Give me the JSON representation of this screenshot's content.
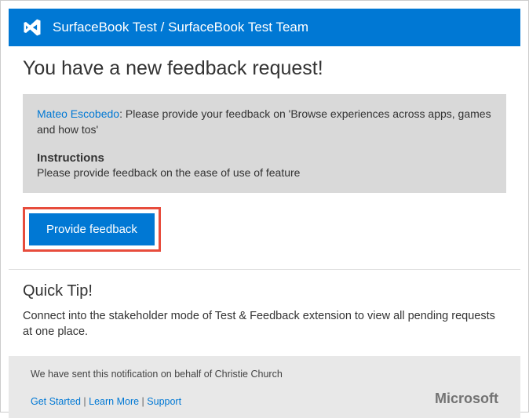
{
  "header": {
    "title": "SurfaceBook Test / SurfaceBook Test Team"
  },
  "main": {
    "heading": "You have a new feedback request!",
    "requester_name": "Mateo Escobedo",
    "request_separator": ": ",
    "request_text": "Please provide your feedback on 'Browse experiences across  apps, games and how tos'",
    "instructions_label": "Instructions",
    "instructions_text": "Please provide feedback on the ease of use of feature",
    "button_label": "Provide feedback"
  },
  "tip": {
    "heading": "Quick Tip!",
    "text": "Connect into the stakeholder mode of Test & Feedback extension to view all pending requests at one place."
  },
  "footer": {
    "notice_prefix": "We have sent this notification on behalf of  ",
    "notice_name": "Christie Church",
    "link_get_started": "Get Started",
    "link_learn_more": "Learn More",
    "link_support": "Support",
    "link_separator": " | ",
    "brand": "Microsoft"
  }
}
